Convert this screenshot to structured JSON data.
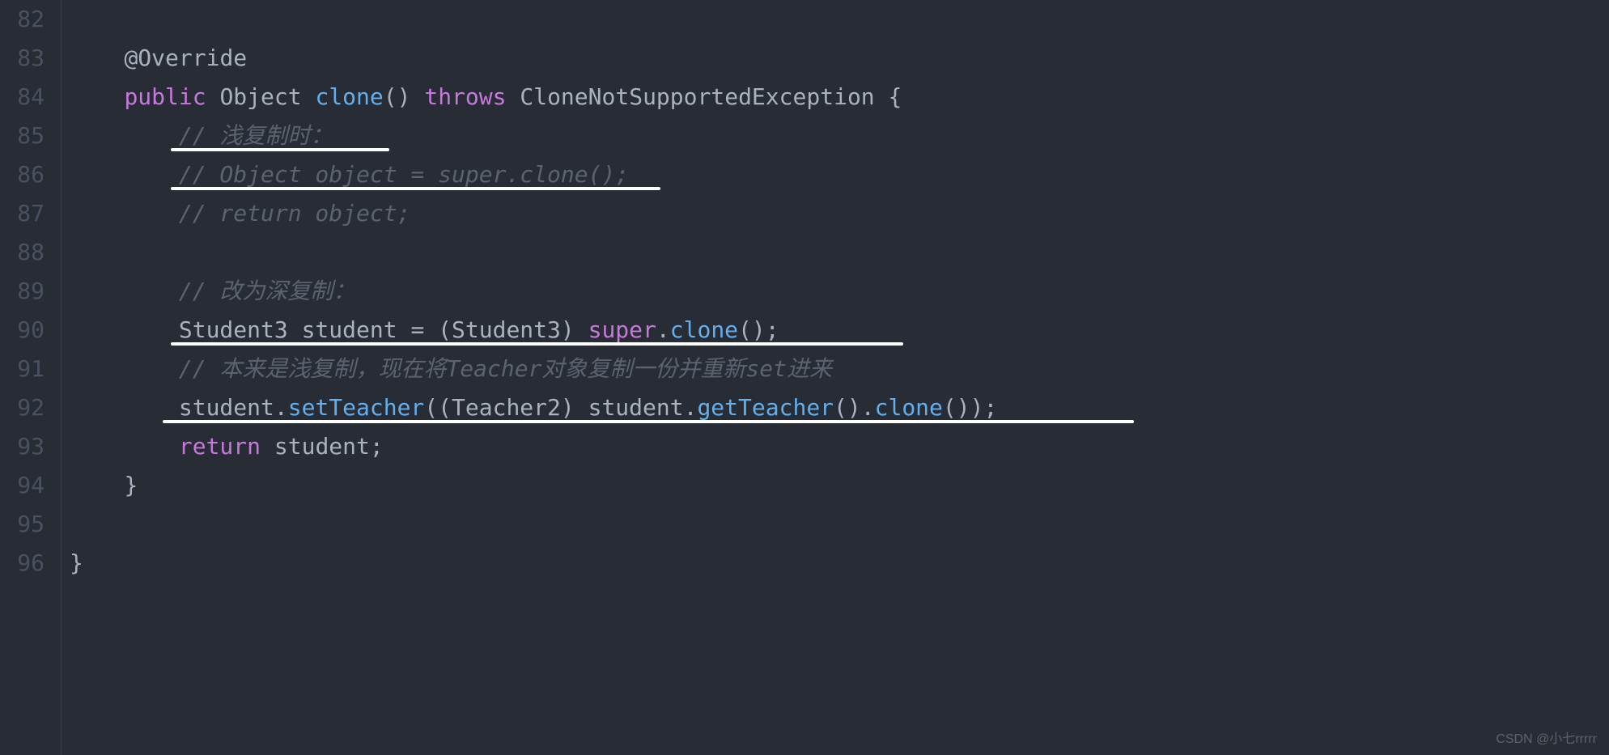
{
  "gutter": {
    "start": 82,
    "end": 96
  },
  "code": {
    "l82": "",
    "l83_indent": "    ",
    "l83_ann": "@Override",
    "l84_indent": "    ",
    "l84_kw1": "public",
    "l84_sp1": " ",
    "l84_type": "Object",
    "l84_sp2": " ",
    "l84_fn": "clone",
    "l84_par": "()",
    "l84_sp3": " ",
    "l84_kw2": "throws",
    "l84_sp4": " ",
    "l84_exc": "CloneNotSupportedException",
    "l84_sp5": " ",
    "l84_brace": "{",
    "l85_indent": "        ",
    "l85_cmt": "// 浅复制时：",
    "l86_indent": "        ",
    "l86_cmt": "// Object object = super.clone();",
    "l87_indent": "        ",
    "l87_cmt": "// return object;",
    "l88": "",
    "l89_indent": "        ",
    "l89_cmt": "// 改为深复制：",
    "l90_indent": "        ",
    "l90_t1": "Student3 student ",
    "l90_op": "=",
    "l90_t2": " (Student3) ",
    "l90_kw": "super",
    "l90_dot": ".",
    "l90_fn": "clone",
    "l90_end": "();",
    "l91_indent": "        ",
    "l91_cmt": "// 本来是浅复制，现在将Teacher对象复制一份并重新set进来",
    "l92_indent": "        ",
    "l92_t1": "student.",
    "l92_fn1": "setTeacher",
    "l92_t2": "((Teacher2) student.",
    "l92_fn2": "getTeacher",
    "l92_t3": "().",
    "l92_fn3": "clone",
    "l92_t4": "());",
    "l93_indent": "        ",
    "l93_kw": "return",
    "l93_t": " student;",
    "l94_indent": "    ",
    "l94_brace": "}",
    "l95": "",
    "l96_brace": "}"
  },
  "line_numbers": [
    "82",
    "83",
    "84",
    "85",
    "86",
    "87",
    "88",
    "89",
    "90",
    "91",
    "92",
    "93",
    "94",
    "95",
    "96"
  ],
  "watermark": "CSDN @小七rrrrr"
}
